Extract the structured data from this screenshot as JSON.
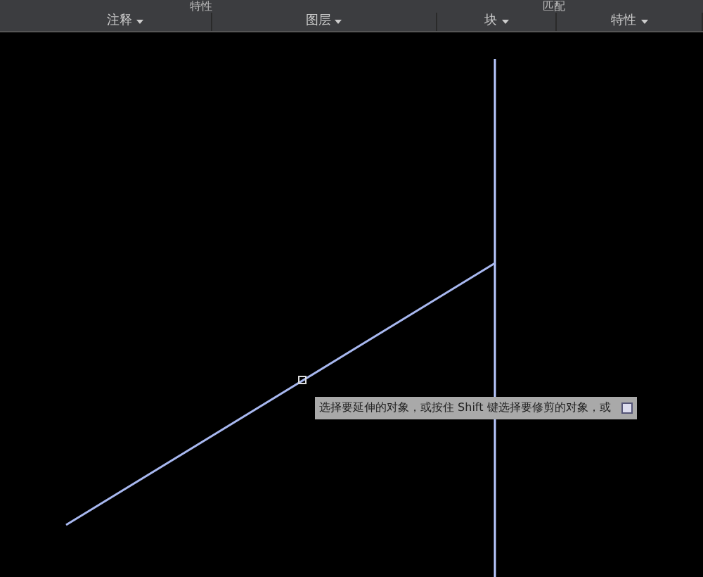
{
  "ribbon": {
    "top_texts": [
      "特性",
      "匹配"
    ],
    "panels": [
      {
        "label": "注释"
      },
      {
        "label": "图层"
      },
      {
        "label": "块"
      },
      {
        "label": "特性"
      }
    ]
  },
  "tooltip": {
    "text": "选择要延伸的对象，或按住 Shift 键选择要修剪的对象，或"
  }
}
